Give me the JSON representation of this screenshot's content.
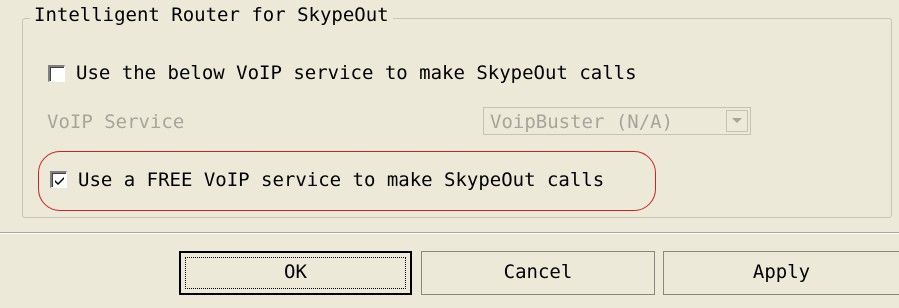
{
  "group": {
    "title": "Intelligent Router for SkypeOut"
  },
  "options": {
    "use_below_label": "Use the below VoIP service to make SkypeOut calls",
    "use_below_checked": false,
    "voip_service_label": "VoIP Service",
    "voip_service_value": "VoipBuster (N/A)",
    "use_free_label": "Use a FREE VoIP service to make SkypeOut calls",
    "use_free_checked": true
  },
  "buttons": {
    "ok": "OK",
    "cancel": "Cancel",
    "apply": "Apply"
  },
  "colors": {
    "background": "#ece9d8",
    "disabled_text": "#a7a59a",
    "highlight": "#d12020"
  }
}
